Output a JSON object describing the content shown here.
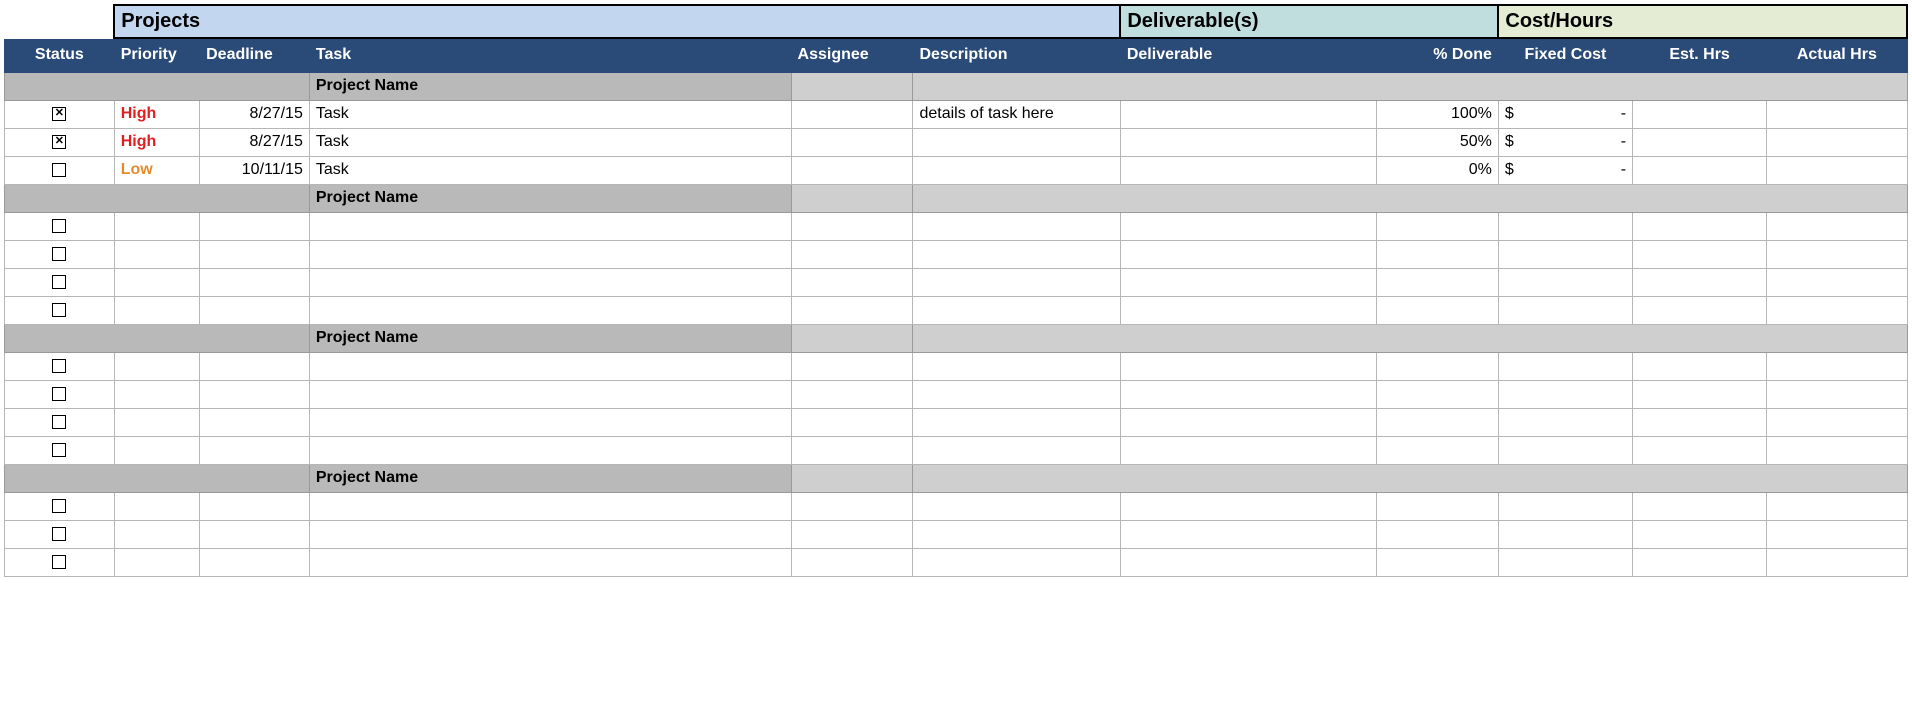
{
  "sections": {
    "projects": "Projects",
    "deliverables": "Deliverable(s)",
    "cost": "Cost/Hours"
  },
  "columns": {
    "status": "Status",
    "priority": "Priority",
    "deadline": "Deadline",
    "task": "Task",
    "assignee": "Assignee",
    "description": "Description",
    "deliverable": "Deliverable",
    "pct_done": "% Done",
    "fixed_cost": "Fixed Cost",
    "est_hrs": "Est. Hrs",
    "actual_hrs": "Actual Hrs"
  },
  "groups": [
    {
      "name": "Project Name",
      "rows": [
        {
          "checked": true,
          "priority": "High",
          "priority_class": "priority-high",
          "deadline": "8/27/15",
          "task": "Task",
          "assignee": "",
          "description": "details of task here",
          "deliverable": "",
          "pct_done": "100%",
          "fixed_cost_sym": "$",
          "fixed_cost_val": "-",
          "est_hrs": "",
          "actual_hrs": ""
        },
        {
          "checked": true,
          "priority": "High",
          "priority_class": "priority-high",
          "deadline": "8/27/15",
          "task": "Task",
          "assignee": "",
          "description": "",
          "deliverable": "",
          "pct_done": "50%",
          "fixed_cost_sym": "$",
          "fixed_cost_val": "-",
          "est_hrs": "",
          "actual_hrs": ""
        },
        {
          "checked": false,
          "priority": "Low",
          "priority_class": "priority-low",
          "deadline": "10/11/15",
          "task": "Task",
          "assignee": "",
          "description": "",
          "deliverable": "",
          "pct_done": "0%",
          "fixed_cost_sym": "$",
          "fixed_cost_val": "-",
          "est_hrs": "",
          "actual_hrs": ""
        }
      ]
    },
    {
      "name": "Project Name",
      "rows": [
        {
          "checked": false,
          "priority": "",
          "priority_class": "",
          "deadline": "",
          "task": "",
          "assignee": "",
          "description": "",
          "deliverable": "",
          "pct_done": "",
          "fixed_cost_sym": "",
          "fixed_cost_val": "",
          "est_hrs": "",
          "actual_hrs": ""
        },
        {
          "checked": false,
          "priority": "",
          "priority_class": "",
          "deadline": "",
          "task": "",
          "assignee": "",
          "description": "",
          "deliverable": "",
          "pct_done": "",
          "fixed_cost_sym": "",
          "fixed_cost_val": "",
          "est_hrs": "",
          "actual_hrs": ""
        },
        {
          "checked": false,
          "priority": "",
          "priority_class": "",
          "deadline": "",
          "task": "",
          "assignee": "",
          "description": "",
          "deliverable": "",
          "pct_done": "",
          "fixed_cost_sym": "",
          "fixed_cost_val": "",
          "est_hrs": "",
          "actual_hrs": ""
        },
        {
          "checked": false,
          "priority": "",
          "priority_class": "",
          "deadline": "",
          "task": "",
          "assignee": "",
          "description": "",
          "deliverable": "",
          "pct_done": "",
          "fixed_cost_sym": "",
          "fixed_cost_val": "",
          "est_hrs": "",
          "actual_hrs": ""
        }
      ]
    },
    {
      "name": "Project Name",
      "rows": [
        {
          "checked": false,
          "priority": "",
          "priority_class": "",
          "deadline": "",
          "task": "",
          "assignee": "",
          "description": "",
          "deliverable": "",
          "pct_done": "",
          "fixed_cost_sym": "",
          "fixed_cost_val": "",
          "est_hrs": "",
          "actual_hrs": ""
        },
        {
          "checked": false,
          "priority": "",
          "priority_class": "",
          "deadline": "",
          "task": "",
          "assignee": "",
          "description": "",
          "deliverable": "",
          "pct_done": "",
          "fixed_cost_sym": "",
          "fixed_cost_val": "",
          "est_hrs": "",
          "actual_hrs": ""
        },
        {
          "checked": false,
          "priority": "",
          "priority_class": "",
          "deadline": "",
          "task": "",
          "assignee": "",
          "description": "",
          "deliverable": "",
          "pct_done": "",
          "fixed_cost_sym": "",
          "fixed_cost_val": "",
          "est_hrs": "",
          "actual_hrs": ""
        },
        {
          "checked": false,
          "priority": "",
          "priority_class": "",
          "deadline": "",
          "task": "",
          "assignee": "",
          "description": "",
          "deliverable": "",
          "pct_done": "",
          "fixed_cost_sym": "",
          "fixed_cost_val": "",
          "est_hrs": "",
          "actual_hrs": ""
        }
      ]
    },
    {
      "name": "Project Name",
      "rows": [
        {
          "checked": false,
          "priority": "",
          "priority_class": "",
          "deadline": "",
          "task": "",
          "assignee": "",
          "description": "",
          "deliverable": "",
          "pct_done": "",
          "fixed_cost_sym": "",
          "fixed_cost_val": "",
          "est_hrs": "",
          "actual_hrs": ""
        },
        {
          "checked": false,
          "priority": "",
          "priority_class": "",
          "deadline": "",
          "task": "",
          "assignee": "",
          "description": "",
          "deliverable": "",
          "pct_done": "",
          "fixed_cost_sym": "",
          "fixed_cost_val": "",
          "est_hrs": "",
          "actual_hrs": ""
        },
        {
          "checked": false,
          "priority": "",
          "priority_class": "",
          "deadline": "",
          "task": "",
          "assignee": "",
          "description": "",
          "deliverable": "",
          "pct_done": "",
          "fixed_cost_sym": "",
          "fixed_cost_val": "",
          "est_hrs": "",
          "actual_hrs": ""
        }
      ]
    }
  ]
}
